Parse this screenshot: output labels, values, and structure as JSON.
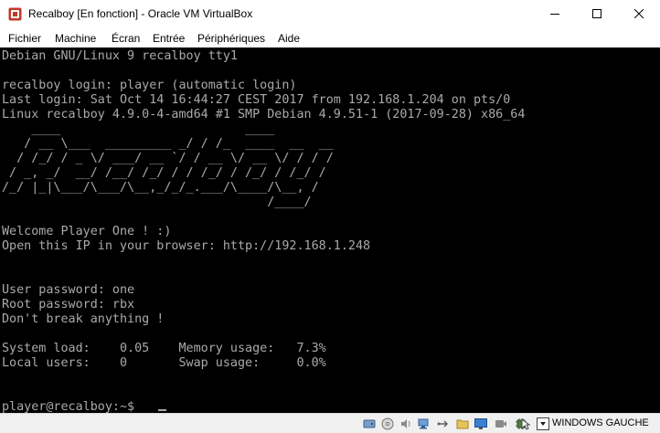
{
  "window": {
    "title": "Recalboy [En fonction] - Oracle VM VirtualBox",
    "icon": "virtualbox-app-icon",
    "controls": [
      "minimize-icon",
      "maximize-icon",
      "close-icon"
    ]
  },
  "menu": {
    "items": [
      "Fichier",
      "Machine",
      "Écran",
      "Entrée",
      "Périphériques",
      "Aide"
    ]
  },
  "console": {
    "lines": [
      "Debian GNU/Linux 9 recalboy tty1",
      "",
      "recalboy login: player (automatic login)",
      "Last login: Sat Oct 14 16:44:27 CEST 2017 from 192.168.1.204 on pts/0",
      "Linux recalboy 4.9.0-4-amd64 #1 SMP Debian 4.9.51-1 (2017-09-28) x86_64",
      "    ____                         ____",
      "   / __ \\___  _________ _/ / /_  ____  __  __",
      "  / /_/ / _ \\/ ___/ __ `/ / __ \\/ __ \\/ / / /",
      " / _, _/  __/ /__/ /_/ / / /_/ / /_/ / /_/ /",
      "/_/ |_|\\___/\\___/\\__,_/_/_.___/\\____/\\__, /",
      "                                    /____/",
      "",
      "Welcome Player One ! :)",
      "Open this IP in your browser: http://192.168.1.248",
      "",
      "",
      "User password: one",
      "Root password: rbx",
      "Don't break anything !",
      "",
      "System load:    0.05    Memory usage:   7.3%",
      "Local users:    0       Swap usage:     0.0%",
      "",
      "",
      "player@recalboy:~$ "
    ],
    "text_color": "#aaaaaa",
    "background": "#000000"
  },
  "statusbar": {
    "icons": [
      "hard-disk-icon",
      "optical-drive-icon",
      "audio-icon",
      "network-icon",
      "usb-icon",
      "shared-folders-icon",
      "display-icon",
      "video-capture-icon",
      "cpu-icon",
      "mouse-integration-icon",
      "host-key-arrow-icon"
    ],
    "host_key": "WINDOWS GAUCHE"
  }
}
